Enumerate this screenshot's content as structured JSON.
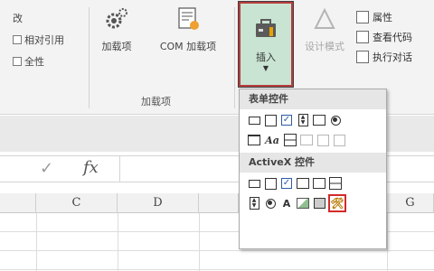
{
  "ribbon": {
    "left_rows": [
      "改",
      "相对引用",
      "全性"
    ],
    "addins_label": "加载项",
    "com_addins_label": "COM 加载项",
    "group_label": "加载项",
    "insert_label": "插入",
    "design_mode_label": "设计模式",
    "right_items": [
      "属性",
      "查看代码",
      "执行对话"
    ]
  },
  "dropdown": {
    "form_controls_header": "表单控件",
    "activex_header": "ActiveX 控件",
    "label_text": "Aa",
    "activex_label_text": "A",
    "selected_control": "more-controls"
  },
  "formula_bar": {
    "enter_symbol": "✓",
    "fx_symbol": "fx"
  },
  "columns": [
    "C",
    "D",
    "G"
  ],
  "colors": {
    "insert_bg": "#c9e4d2",
    "highlight_border": "#b83c3c"
  }
}
